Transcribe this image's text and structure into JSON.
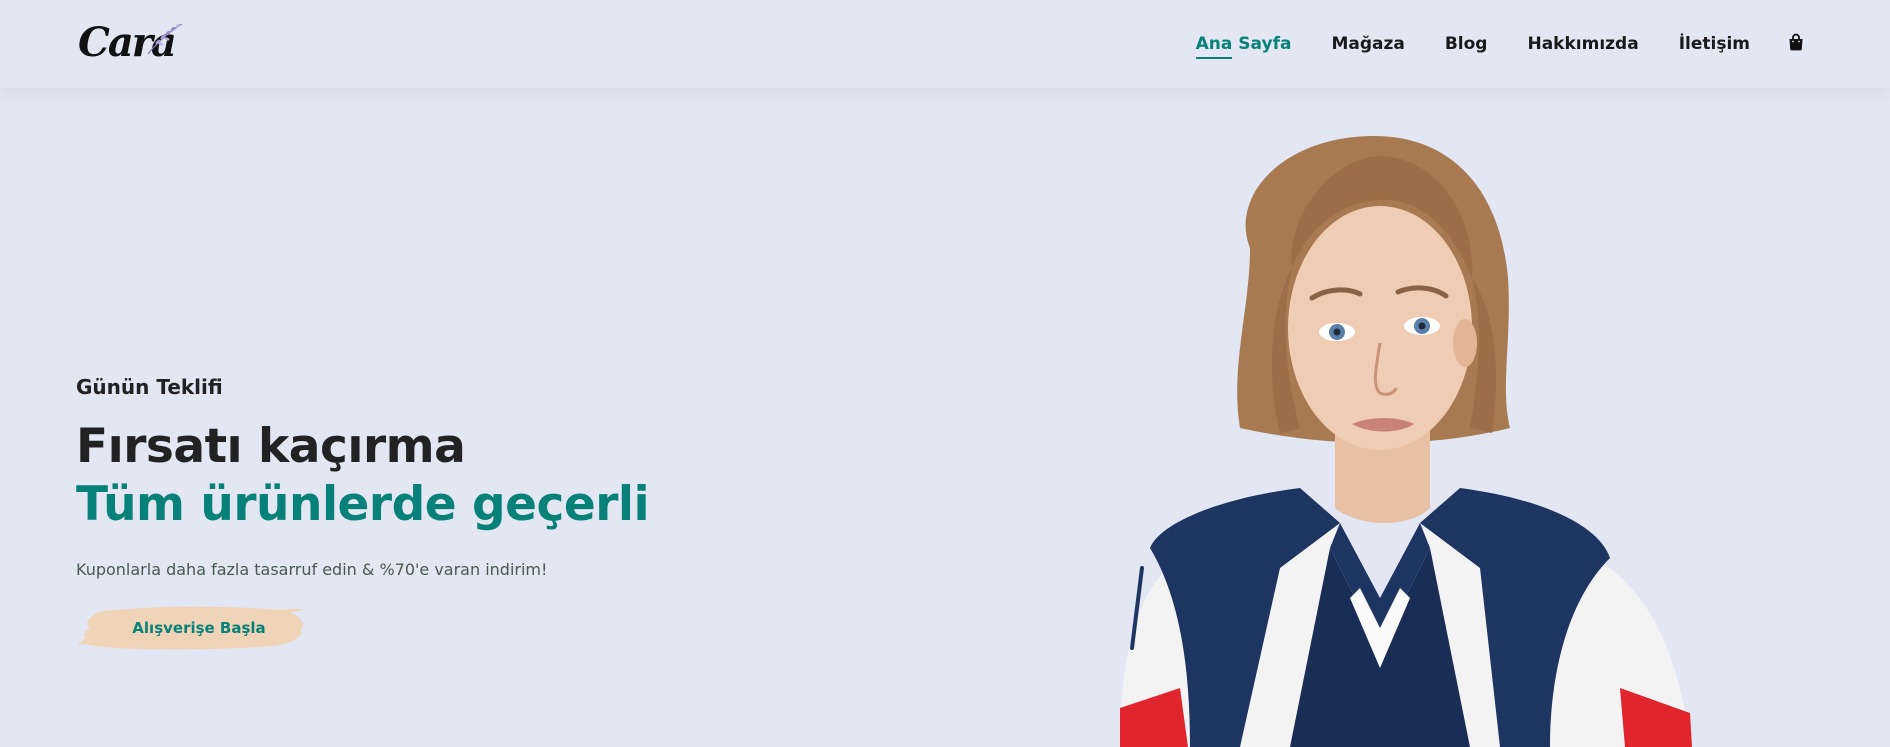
{
  "header": {
    "logo_text": "Cara",
    "nav": [
      {
        "label": "Ana Sayfa",
        "active": true
      },
      {
        "label": "Mağaza",
        "active": false
      },
      {
        "label": "Blog",
        "active": false
      },
      {
        "label": "Hakkımızda",
        "active": false
      },
      {
        "label": "İletişim",
        "active": false
      }
    ],
    "cart_icon": "shopping-bag-icon"
  },
  "hero": {
    "eyebrow": "Günün Teklifi",
    "title_line1": "Fırsatı kaçırma",
    "title_line2": "Tüm ürünlerde geçerli",
    "subtitle": "Kuponlarla daha fazla tasarruf edin & %70'e varan indirim!",
    "cta_label": "Alışverişe Başla"
  },
  "colors": {
    "background": "#e3e6f3",
    "accent": "#088178",
    "text_dark": "#222222",
    "button_brush": "#f0d4b8"
  }
}
